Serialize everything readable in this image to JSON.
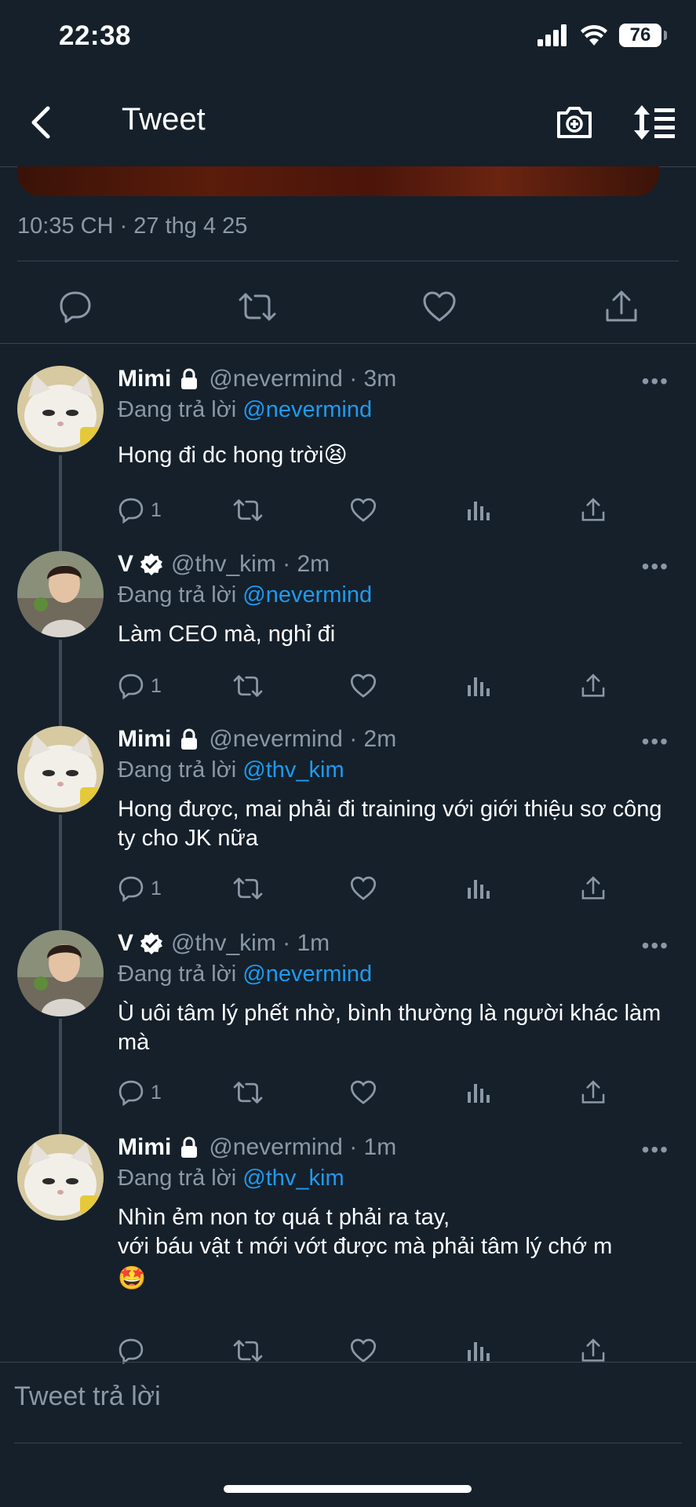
{
  "status_bar": {
    "time": "22:38",
    "battery_level": "76",
    "icons": [
      "signal-icon",
      "wifi-icon",
      "battery-icon"
    ]
  },
  "header": {
    "title": "Tweet",
    "icons": [
      "back-chevron-icon",
      "camera-plus-icon",
      "sort-icon"
    ]
  },
  "tweet": {
    "timestamp": "10:35 CH · 27 thg 4 25",
    "action_icons": [
      "reply-icon",
      "retweet-icon",
      "like-icon",
      "share-icon"
    ]
  },
  "replies": [
    {
      "name": "Mimi",
      "badge": "lock-icon",
      "meta": "@nevermind · 3m",
      "replying_prefix": "Đang trả lời ",
      "replying_to": "@nevermind",
      "text": "Hong đi dc hong trời😫",
      "reply_count": "1"
    },
    {
      "name": "V",
      "badge": "verified-icon",
      "meta": "@thv_kim · 2m",
      "replying_prefix": "Đang trả lời ",
      "replying_to": "@nevermind",
      "text": "Làm CEO mà, nghỉ đi",
      "reply_count": "1"
    },
    {
      "name": "Mimi",
      "badge": "lock-icon",
      "meta": "@nevermind · 2m",
      "replying_prefix": "Đang trả lời ",
      "replying_to": "@thv_kim",
      "text": "Hong được, mai phải đi training với giới thiệu sơ công ty cho JK nữa",
      "reply_count": "1"
    },
    {
      "name": "V",
      "badge": "verified-icon",
      "meta": "@thv_kim · 1m",
      "replying_prefix": "Đang trả lời ",
      "replying_to": "@nevermind",
      "text": "Ù uôi tâm lý phết nhờ, bình thường là người khác làm mà",
      "reply_count": "1"
    },
    {
      "name": "Mimi",
      "badge": "lock-icon",
      "meta": "@nevermind · 1m",
      "replying_prefix": "Đang trả lời ",
      "replying_to": "@thv_kim",
      "text_line1": "Nhìn ẻm non tơ quá t phải ra tay,",
      "text_line2": "với báu vật t mới vớt được mà phải tâm lý chớ m",
      "text_line3": "🤩",
      "reply_count": ""
    }
  ],
  "reply_box": {
    "placeholder": "Tweet trả lời"
  },
  "more_label": "•••"
}
